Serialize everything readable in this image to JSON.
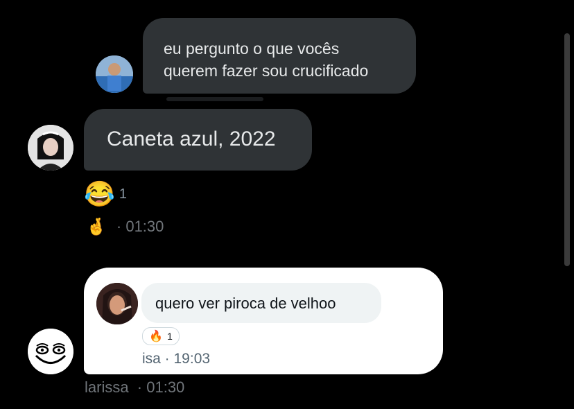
{
  "messages": [
    {
      "text_line1": "eu pergunto o que vocês",
      "text_line2": "querem fazer sou crucificado"
    },
    {
      "text": "Caneta azul, 2022",
      "reaction_emoji": "😂",
      "reaction_count": "1",
      "sender_emoji": "🤞",
      "meta": "· 01:30"
    },
    {
      "quoted_text": "quero ver piroca de velhoo",
      "quoted_reaction_emoji": "🔥",
      "quoted_reaction_count": "1",
      "quoted_meta": "isa · 19:03",
      "meta": "larissa  · 01:30"
    }
  ],
  "colors": {
    "background": "#000000",
    "bubble_dark": "#2f3336",
    "bubble_light": "#ffffff",
    "quoted_bubble": "#eff3f4",
    "meta_text": "#71767b"
  }
}
